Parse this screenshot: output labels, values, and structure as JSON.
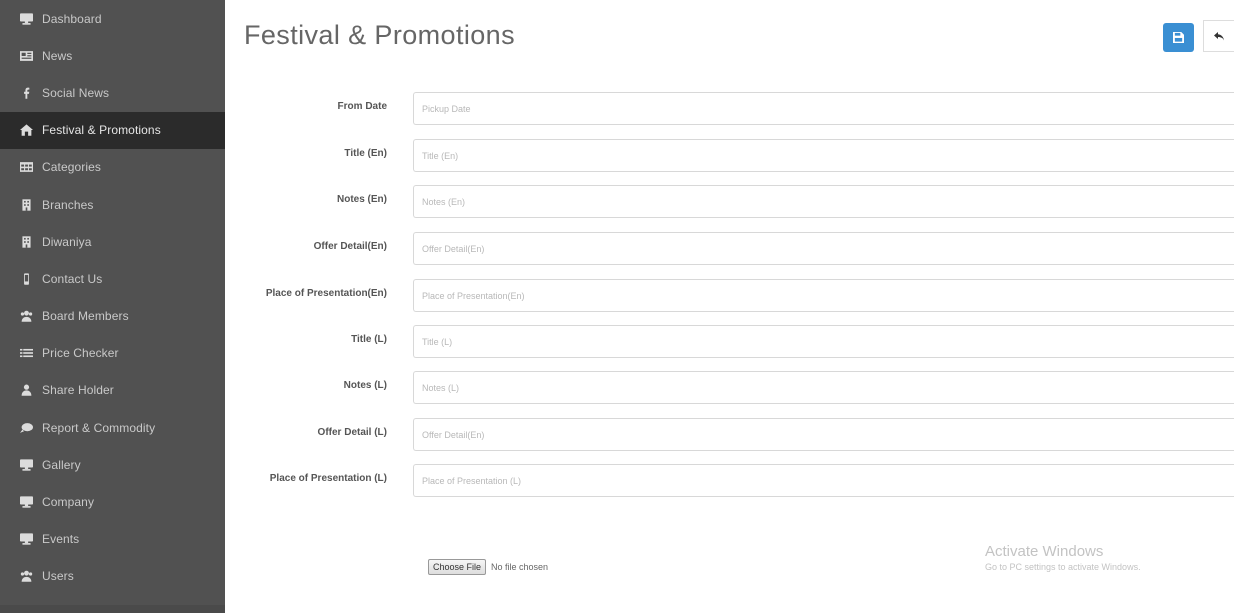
{
  "sidebar": {
    "items": [
      {
        "label": "Dashboard",
        "icon": "monitor-icon"
      },
      {
        "label": "News",
        "icon": "newspaper-icon"
      },
      {
        "label": "Social News",
        "icon": "facebook-icon"
      },
      {
        "label": "Festival & Promotions",
        "icon": "home-icon",
        "active": true
      },
      {
        "label": "Categories",
        "icon": "table-icon"
      },
      {
        "label": "Branches",
        "icon": "building-icon"
      },
      {
        "label": "Diwaniya",
        "icon": "building-icon"
      },
      {
        "label": "Contact Us",
        "icon": "mobile-icon"
      },
      {
        "label": "Board Members",
        "icon": "users-icon"
      },
      {
        "label": "Price Checker",
        "icon": "list-icon"
      },
      {
        "label": "Share Holder",
        "icon": "user-icon"
      },
      {
        "label": "Report & Commodity",
        "icon": "comment-icon"
      },
      {
        "label": "Gallery",
        "icon": "monitor-icon"
      },
      {
        "label": "Company",
        "icon": "monitor-icon"
      },
      {
        "label": "Events",
        "icon": "monitor-icon"
      },
      {
        "label": "Users",
        "icon": "users-icon"
      }
    ]
  },
  "header": {
    "title": "Festival & Promotions"
  },
  "form": {
    "fields": [
      {
        "label": "From Date",
        "placeholder": "Pickup Date"
      },
      {
        "label": "Title (En)",
        "placeholder": "Title (En)"
      },
      {
        "label": "Notes (En)",
        "placeholder": "Notes (En)"
      },
      {
        "label": "Offer Detail(En)",
        "placeholder": "Offer Detail(En)"
      },
      {
        "label": "Place of Presentation(En)",
        "placeholder": "Place of Presentation(En)"
      },
      {
        "label": "Title (L)",
        "placeholder": "Title (L)"
      },
      {
        "label": "Notes (L)",
        "placeholder": "Notes (L)"
      },
      {
        "label": "Offer Detail (L)",
        "placeholder": "Offer Detail(En)"
      },
      {
        "label": "Place of Presentation (L)",
        "placeholder": "Place of Presentation (L)"
      }
    ],
    "file": {
      "button_label": "Choose File",
      "status": "No file chosen"
    }
  },
  "watermark": {
    "line1": "Activate Windows",
    "line2": "Go to PC settings to activate Windows."
  },
  "colors": {
    "sidebar_bg": "#515151",
    "sidebar_active_bg": "#2b2b2b",
    "primary_button": "#3a8fd3"
  }
}
